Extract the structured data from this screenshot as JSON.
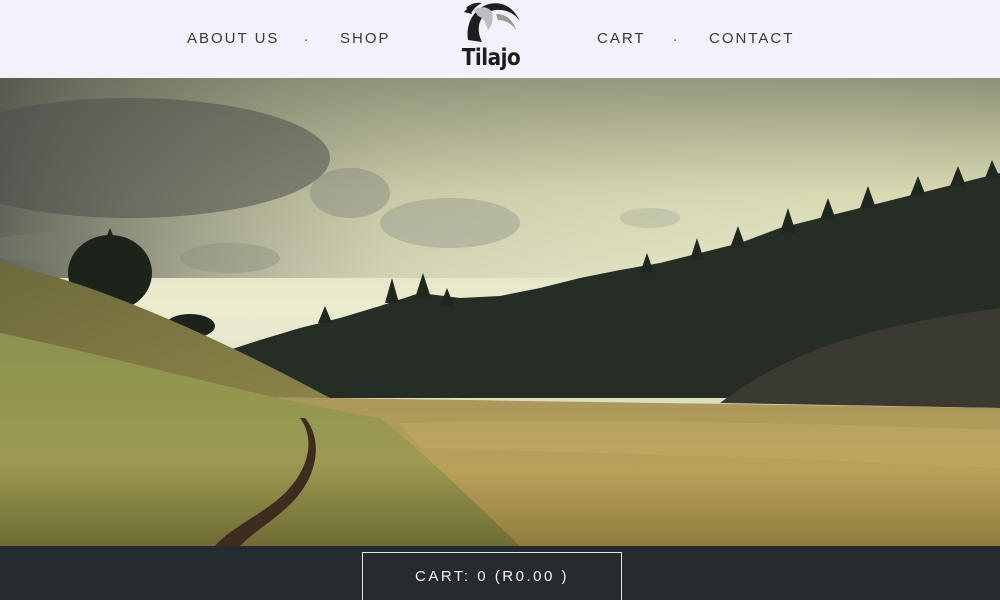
{
  "nav": {
    "left": [
      {
        "label": "ABOUT US"
      },
      {
        "label": "SHOP"
      }
    ],
    "right": [
      {
        "label": "CART"
      },
      {
        "label": "CONTACT"
      }
    ],
    "separator": "."
  },
  "logo": {
    "text": "Tilajo",
    "icon": "horse-head-icon"
  },
  "hero": {
    "image": "meadow-forest-landscape"
  },
  "cart_bar": {
    "label": "CART: 0 (R0.00 )"
  }
}
